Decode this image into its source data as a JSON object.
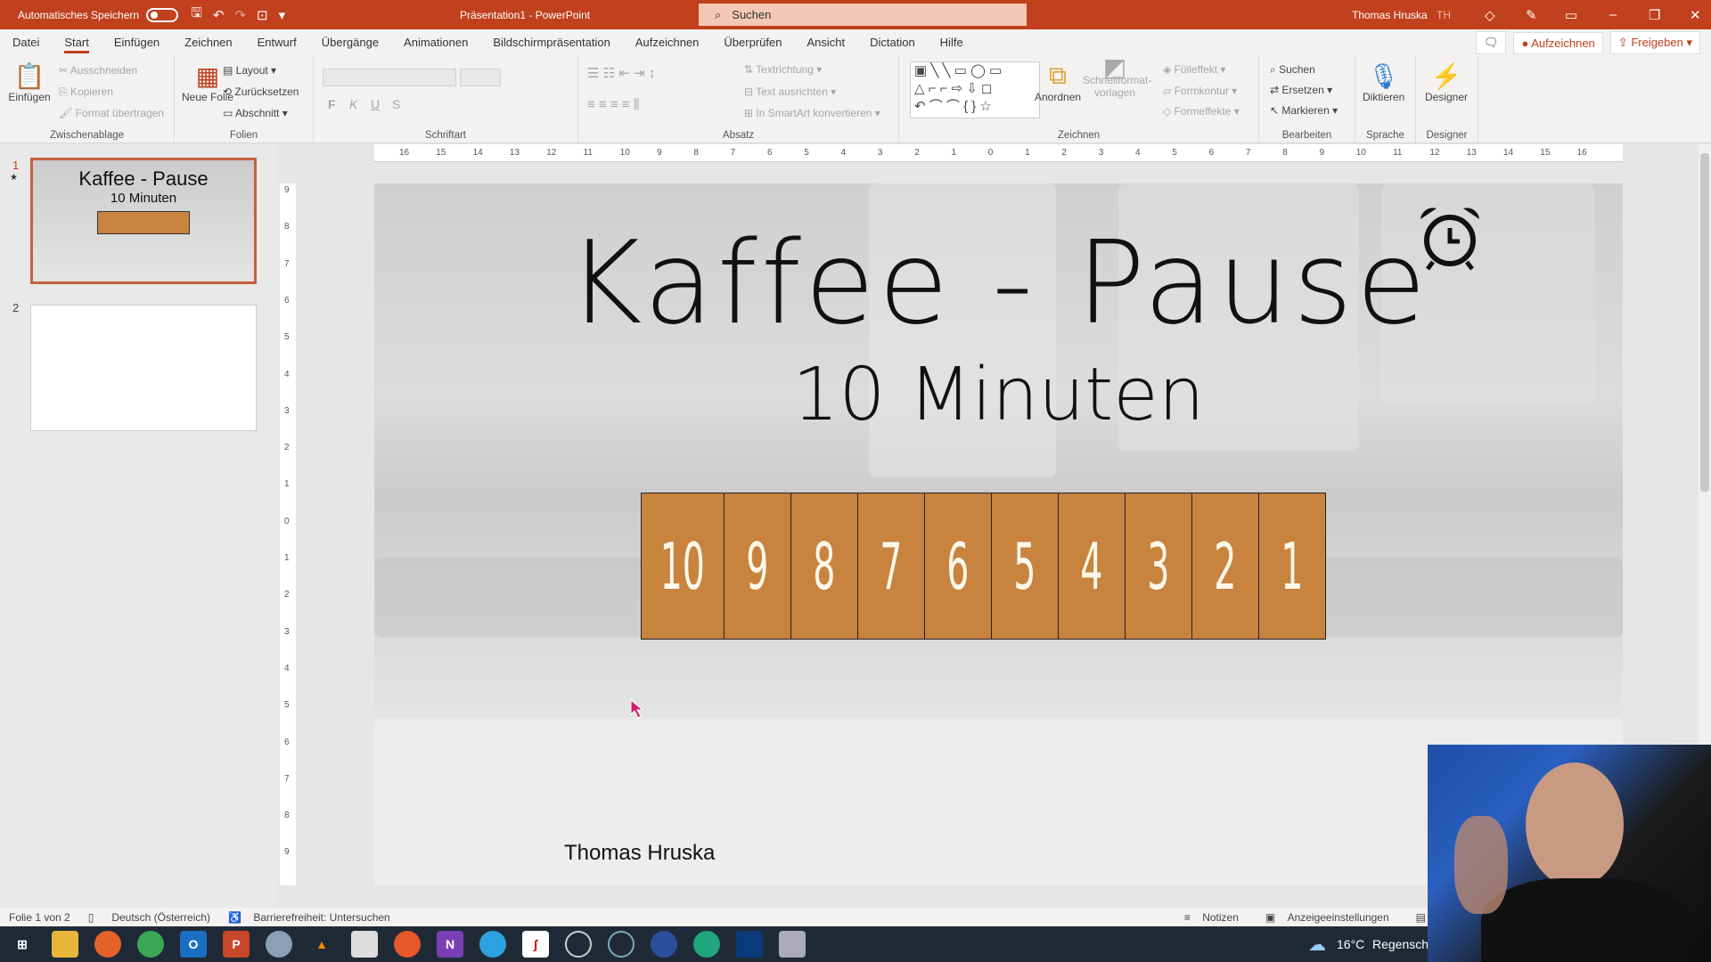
{
  "titlebar": {
    "autosave_label": "Automatisches Speichern",
    "doc_title": "Präsentation1 - PowerPoint",
    "search_placeholder": "Suchen",
    "user_name": "Thomas Hruska",
    "user_initials": "TH"
  },
  "menu": {
    "tabs": [
      "Datei",
      "Start",
      "Einfügen",
      "Zeichnen",
      "Entwurf",
      "Übergänge",
      "Animationen",
      "Bildschirmpräsentation",
      "Aufzeichnen",
      "Überprüfen",
      "Ansicht",
      "Dictation",
      "Hilfe"
    ],
    "active": "Start",
    "record_button": "Aufzeichnen",
    "share_button": "Freigeben"
  },
  "ribbon": {
    "clipboard": {
      "label": "Zwischenablage",
      "paste": "Einfügen",
      "cut": "Ausschneiden",
      "copy": "Kopieren",
      "format_painter": "Format übertragen"
    },
    "slides": {
      "label": "Folien",
      "new_slide": "Neue Folie",
      "layout": "Layout",
      "reset": "Zurücksetzen",
      "section": "Abschnitt"
    },
    "font": {
      "label": "Schriftart",
      "bold": "F",
      "italic": "K",
      "underline": "U",
      "strike": "S"
    },
    "paragraph": {
      "label": "Absatz",
      "text_direction": "Textrichtung",
      "align_text": "Text ausrichten",
      "smartart": "In SmartArt konvertieren"
    },
    "drawing": {
      "label": "Zeichnen",
      "arrange": "Anordnen",
      "quick_styles": "Schnellformat-vorlagen",
      "fill": "Fülleffekt",
      "outline": "Formkontur",
      "effects": "Formeffekte"
    },
    "editing": {
      "label": "Bearbeiten",
      "find": "Suchen",
      "replace": "Ersetzen",
      "select": "Markieren"
    },
    "voice": {
      "label": "Sprache",
      "dictate": "Diktieren"
    },
    "designer": {
      "label": "Designer",
      "button": "Designer"
    }
  },
  "ruler_h": [
    "16",
    "15",
    "14",
    "13",
    "12",
    "11",
    "10",
    "9",
    "8",
    "7",
    "6",
    "5",
    "4",
    "3",
    "2",
    "1",
    "0",
    "1",
    "2",
    "3",
    "4",
    "5",
    "6",
    "7",
    "8",
    "9",
    "10",
    "11",
    "12",
    "13",
    "14",
    "15",
    "16"
  ],
  "ruler_v": [
    "9",
    "8",
    "7",
    "6",
    "5",
    "4",
    "3",
    "2",
    "1",
    "0",
    "1",
    "2",
    "3",
    "4",
    "5",
    "6",
    "7",
    "8",
    "9"
  ],
  "thumbnails": [
    {
      "number": "1",
      "marker": "★",
      "title": "Kaffee - Pause",
      "subtitle": "10 Minuten"
    },
    {
      "number": "2"
    }
  ],
  "slide": {
    "title": "Kaffee - Pause",
    "subtitle": "10 Minuten",
    "countdown": [
      "10",
      "9",
      "8",
      "7",
      "6",
      "5",
      "4",
      "3",
      "2",
      "1"
    ],
    "author": "Thomas Hruska",
    "box_color": "#c8833f"
  },
  "statusbar": {
    "slide_info": "Folie 1 von 2",
    "language": "Deutsch (Österreich)",
    "accessibility": "Barrierefreiheit: Untersuchen",
    "notes": "Notizen",
    "display_settings": "Anzeigeeinstellungen"
  },
  "taskbar": {
    "weather": "16°C",
    "weather_text": "Regensch"
  },
  "colors": {
    "accent": "#c1401d",
    "taskbar": "#1f2a36"
  }
}
